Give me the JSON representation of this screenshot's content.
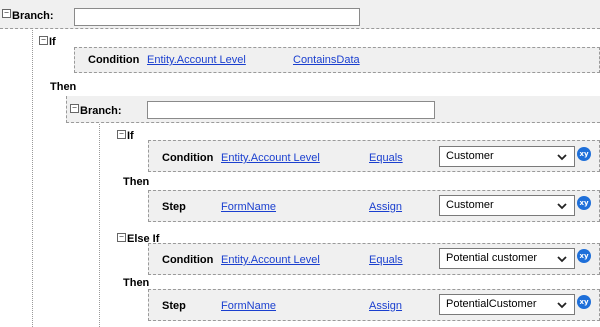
{
  "root": {
    "branch_label": "Branch:",
    "if_label": "If",
    "condition": {
      "label": "Condition",
      "field": "Entity.Account Level",
      "operator": "ContainsData"
    },
    "then_label": "Then",
    "inner_branch": {
      "branch_label": "Branch:",
      "if_label": "If",
      "if_condition": {
        "label": "Condition",
        "field": "Entity.Account Level",
        "operator": "Equals",
        "value": "Customer"
      },
      "then1_label": "Then",
      "step1": {
        "label": "Step",
        "field": "FormName",
        "operator": "Assign",
        "value": "Customer"
      },
      "elseif_label": "Else If",
      "elseif_condition": {
        "label": "Condition",
        "field": "Entity.Account Level",
        "operator": "Equals",
        "value": "Potential customer"
      },
      "then2_label": "Then",
      "step2": {
        "label": "Step",
        "field": "FormName",
        "operator": "Assign",
        "value": "PotentialCustomer"
      }
    }
  },
  "icons": {
    "collapse": "minus-box-icon",
    "expression": "xy-icon",
    "dropdown": "chevron-down-icon"
  },
  "xy_text": "xy",
  "toggle_glyph": "−",
  "colors": {
    "panel_bg": "#f0f0f0",
    "link": "#1a3fcf",
    "xy_badge": "#1e6fd9"
  }
}
